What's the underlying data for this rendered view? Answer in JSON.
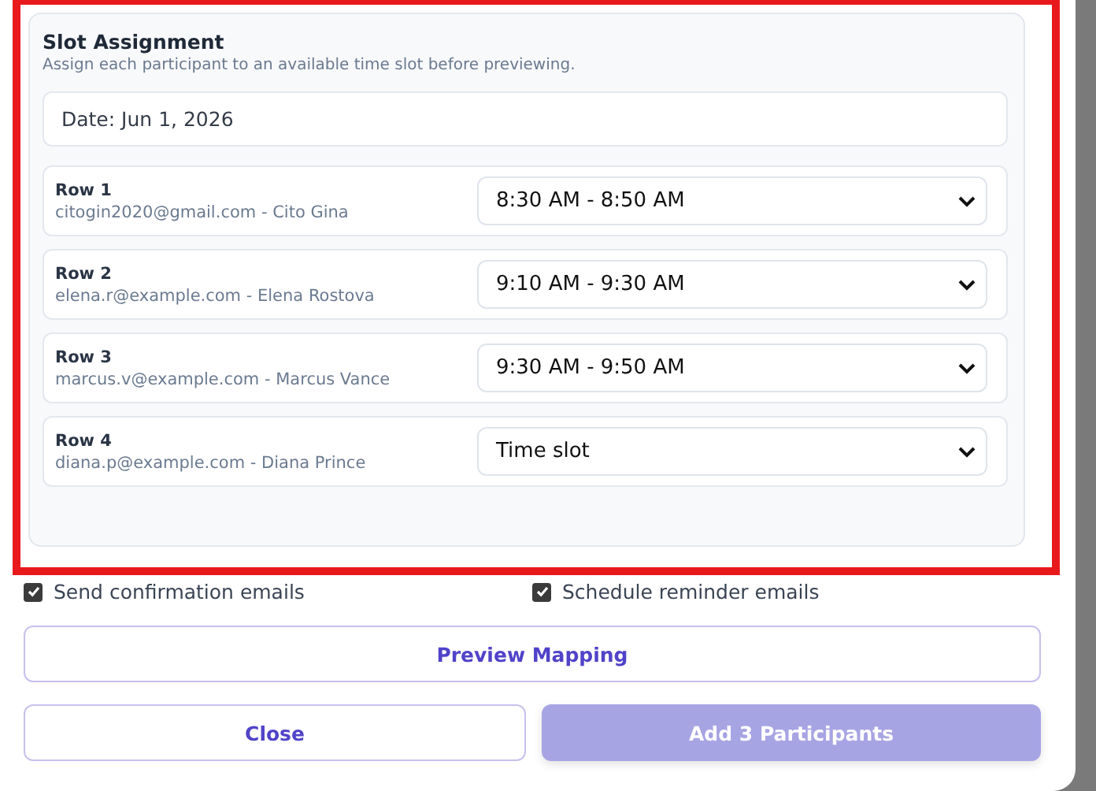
{
  "slot_assignment": {
    "title": "Slot Assignment",
    "subtitle": "Assign each participant to an available time slot before previewing.",
    "date": "Date: Jun 1, 2026",
    "rows": [
      {
        "label": "Row 1",
        "participant": "citogin2020@gmail.com - Cito Gina",
        "slot": "8:30 AM - 8:50 AM"
      },
      {
        "label": "Row 2",
        "participant": "elena.r@example.com - Elena Rostova",
        "slot": "9:10 AM - 9:30 AM"
      },
      {
        "label": "Row 3",
        "participant": "marcus.v@example.com - Marcus Vance",
        "slot": "9:30 AM - 9:50 AM"
      },
      {
        "label": "Row 4",
        "participant": "diana.p@example.com - Diana Prince",
        "placeholder": "Time slot"
      }
    ]
  },
  "options": [
    {
      "label": "Send confirmation emails",
      "checked": true
    },
    {
      "label": "Schedule reminder emails",
      "checked": true
    }
  ],
  "preview_button": {
    "label": "Preview Mapping"
  },
  "buttons": [
    {
      "label": "Close",
      "kind": "secondary",
      "disabled": false
    },
    {
      "label": "Add 3 Participants",
      "kind": "primary",
      "disabled": true
    }
  ]
}
